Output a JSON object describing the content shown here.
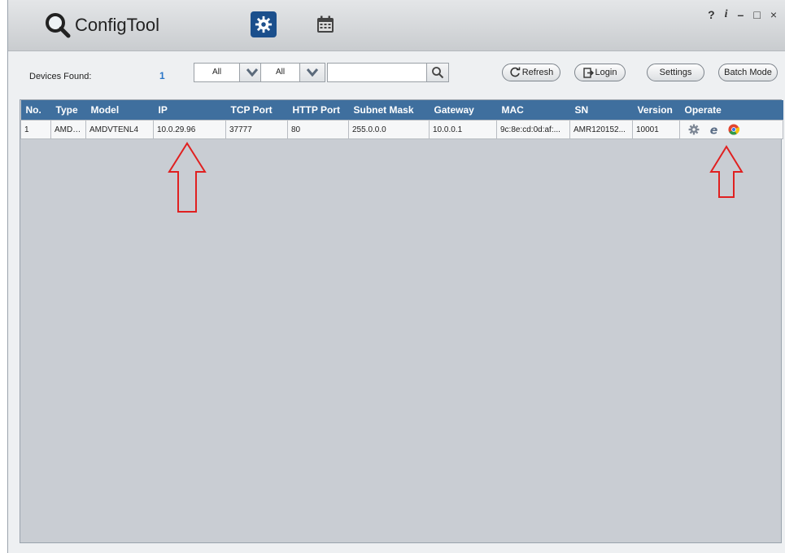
{
  "app": {
    "title": "ConfigTool"
  },
  "nav": {
    "settings_icon": "gear-icon",
    "schedule_icon": "calendar-icon"
  },
  "window_controls": [
    "?",
    "i",
    "–",
    "□",
    "×"
  ],
  "toolbar": {
    "devices_found_label": "Devices Found:",
    "devices_found_count": "1",
    "filter1_value": "All",
    "filter2_value": "All",
    "search_placeholder": "",
    "refresh_label": "Refresh",
    "login_label": "Login",
    "settings_label": "Settings",
    "batch_mode_label": "Batch Mode"
  },
  "table": {
    "columns": [
      "No.",
      "Type",
      "Model",
      "IP",
      "TCP Port",
      "HTTP Port",
      "Subnet Mask",
      "Gateway",
      "MAC",
      "SN",
      "Version",
      "Operate"
    ],
    "rows": [
      {
        "no": "1",
        "type": "AMDV...",
        "model": "AMDVTENL4",
        "ip": "10.0.29.96",
        "tcp_port": "37777",
        "http_port": "80",
        "subnet_mask": "255.0.0.0",
        "gateway": "10.0.0.1",
        "mac": "9c:8e:cd:0d:af:...",
        "sn": "AMR120152...",
        "version": "10001"
      }
    ]
  },
  "colors": {
    "header_bg": "#3f6f9e",
    "accent": "#2b76c8",
    "annotation": "#e02020"
  }
}
